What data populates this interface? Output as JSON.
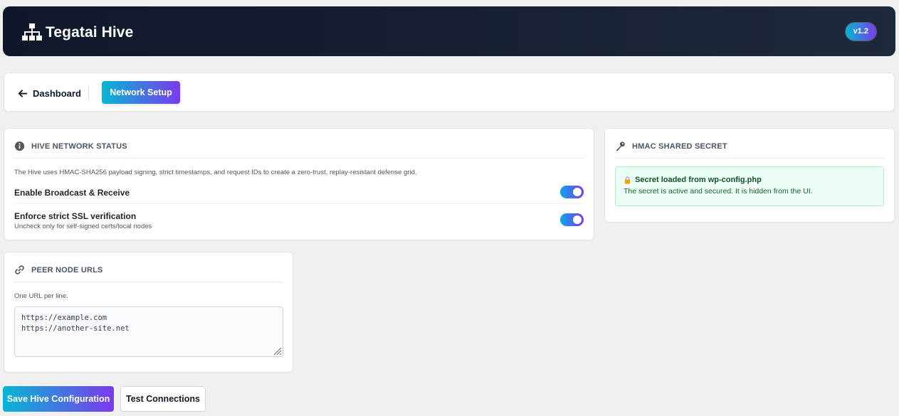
{
  "header": {
    "brand_icon": "sitemap-icon",
    "title": "Tegatai Hive",
    "version": "v1.2"
  },
  "nav": {
    "back_label": "Dashboard",
    "back_icon": "arrow-left-icon",
    "active_tab": "Network Setup"
  },
  "network_status": {
    "icon": "info-circle-icon",
    "title": "HIVE NETWORK STATUS",
    "description": "The Hive uses HMAC-SHA256 payload signing, strict timestamps, and request IDs to create a zero-trust, replay-resistant defense grid.",
    "broadcast": {
      "label": "Enable Broadcast & Receive",
      "enabled": true
    },
    "ssl": {
      "label": "Enforce strict SSL verification",
      "hint": "Uncheck only for self-signed certs/local nodes",
      "enabled": true
    }
  },
  "secret": {
    "icon": "key-icon",
    "title": "HMAC SHARED SECRET",
    "notice_icon": "lock-icon",
    "notice_title": "Secret loaded from wp-config.php",
    "notice_text": "The secret is active and secured. It is hidden from the UI."
  },
  "peers": {
    "icon": "link-icon",
    "title": "PEER NODE URLS",
    "hint": "One URL per line.",
    "urls": "https://example.com\nhttps://another-site.net"
  },
  "actions": {
    "save_label": "Save Hive Configuration",
    "test_label": "Test Connections"
  },
  "colors": {
    "header_bg": "#0f172a",
    "gradient_start": "#06b6d4",
    "gradient_end": "#7c3aed",
    "success_bg": "#ecfdf3",
    "success_text": "#14532d"
  }
}
